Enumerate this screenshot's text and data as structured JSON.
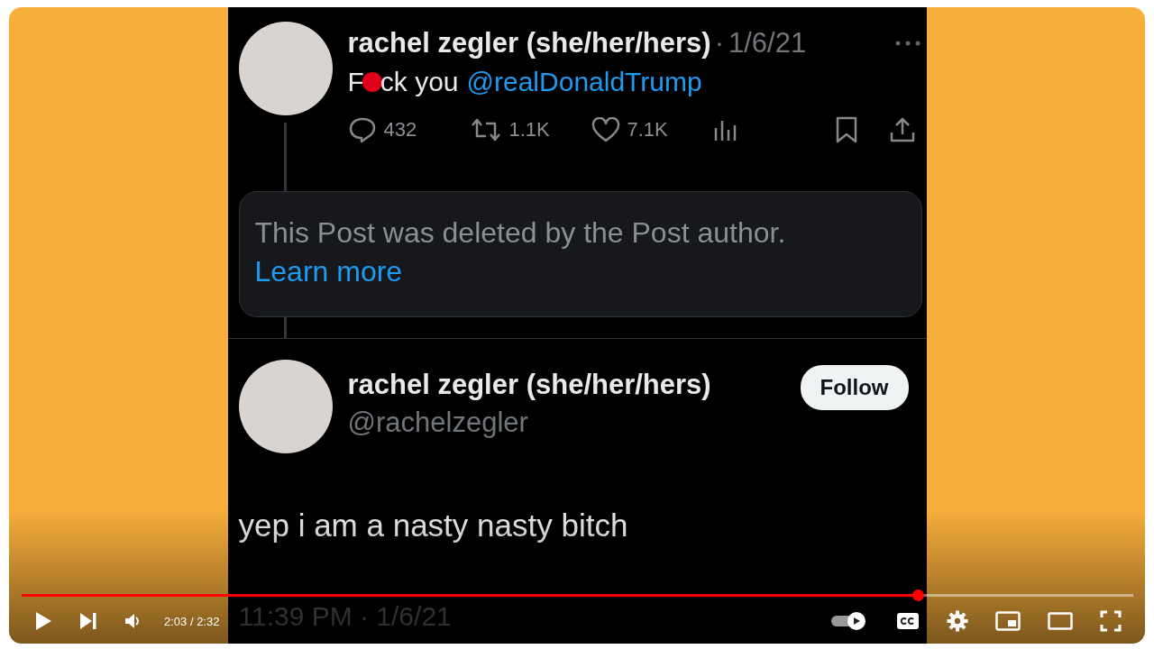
{
  "video_frame": {
    "post": {
      "name": "rachel zegler (she/her/hers)",
      "separator": "·",
      "date": "1/6/21",
      "text_start": "F",
      "text_end": "ck you",
      "mention": "@realDonaldTrump",
      "stats": [
        {
          "kind": "reply",
          "count": "432"
        },
        {
          "kind": "repost",
          "count": "1.1K"
        },
        {
          "kind": "like",
          "count": "7.1K"
        },
        {
          "kind": "views"
        }
      ]
    },
    "deleted_notice": {
      "text": "This Post was deleted by the Post author.",
      "link": "Learn more"
    },
    "reply_post": {
      "name": "rachel zegler (she/her/hers)",
      "follow_button": "Follow",
      "handle": "@rachelzegler",
      "text": "yep i am a nasty nasty bitch",
      "timestamp": "11:39 PM · 1/6/21"
    }
  },
  "player": {
    "progress": {
      "level": 0.807
    },
    "time": "2:03 / 2:32",
    "autoplay": {
      "on": true
    }
  }
}
